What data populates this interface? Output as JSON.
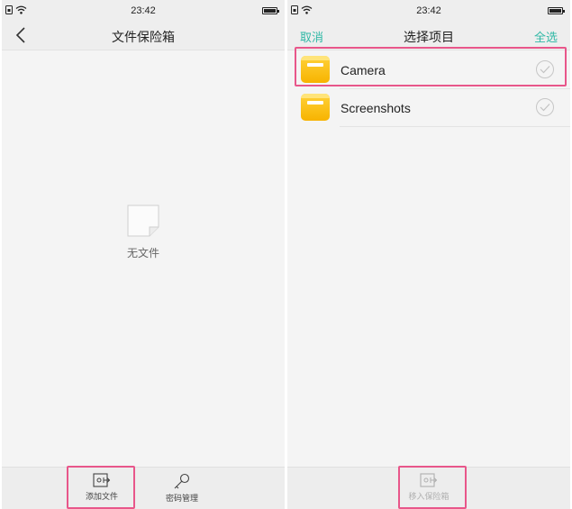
{
  "left_screen": {
    "status_bar": {
      "time": "23:42"
    },
    "nav": {
      "title": "文件保险箱",
      "back_icon": "chevron-left-icon"
    },
    "empty_state": {
      "icon": "blank-document-icon",
      "label": "无文件"
    },
    "toolbar": {
      "add_files_label": "添加文件",
      "password_label": "密码管理"
    }
  },
  "right_screen": {
    "status_bar": {
      "time": "23:42"
    },
    "nav": {
      "cancel_label": "取消",
      "title": "选择项目",
      "select_all_label": "全选"
    },
    "items": [
      {
        "label": "Camera",
        "icon": "yellow-folder-icon",
        "checked": false
      },
      {
        "label": "Screenshots",
        "icon": "yellow-folder-icon",
        "checked": false
      }
    ],
    "toolbar": {
      "move_label": "移入保险箱",
      "enabled": false
    }
  },
  "colors": {
    "accent": "#2fb8a5",
    "highlight": "#e8568a",
    "folder": "#f7b300",
    "background": "#f4f4f4"
  }
}
